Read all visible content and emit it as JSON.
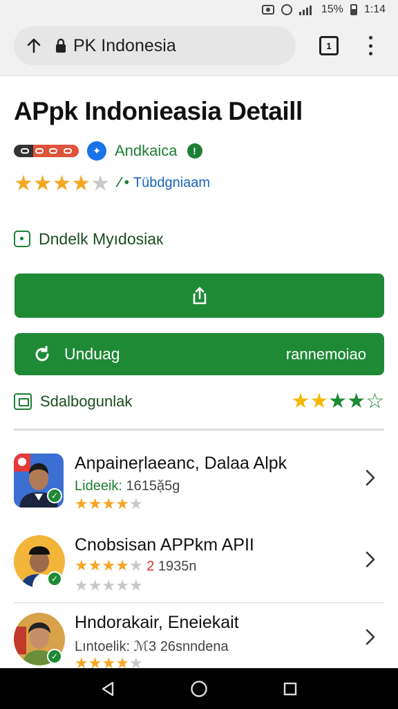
{
  "status_bar": {
    "battery_text": "15%",
    "time": "1:14"
  },
  "browser": {
    "url_text": "PK Indonesia",
    "tab_count": "1"
  },
  "page": {
    "title": "APpk Indonieasia Detaill",
    "developer": "Andkaica",
    "rating": {
      "stars": 4,
      "stat": "⁄ •",
      "category": "Tübdgniaam"
    },
    "download_info": "Dndelk Myıdosiaк",
    "buttons": {
      "primary_icon": "share-icon",
      "secondary_label": "Unduag",
      "secondary_right": "rannemoiao"
    },
    "screenshots_label": "Sdalbogunlak",
    "screenshots_stars": 4
  },
  "list": [
    {
      "title": "Anpaineŗlaeanc, Dalaa Alpk",
      "sub_key": "Lideeik:",
      "sub_value": "1615ặ5g",
      "stars": 4,
      "rank_prefix": ""
    },
    {
      "title": "Cnobsisan APPkm APII",
      "sub_key": "",
      "sub_value": "1935n",
      "stars": 4,
      "rank_prefix": "2"
    },
    {
      "title": "Hndorakair, Eneiekait",
      "sub_key": "Lıntoelik:",
      "sub_value": "ℳ3 26snndena",
      "stars": 4,
      "rank_prefix": ""
    }
  ],
  "colors": {
    "accent_green": "#1e8a36",
    "link_blue": "#1565c0",
    "star_gold": "#f5a623"
  }
}
